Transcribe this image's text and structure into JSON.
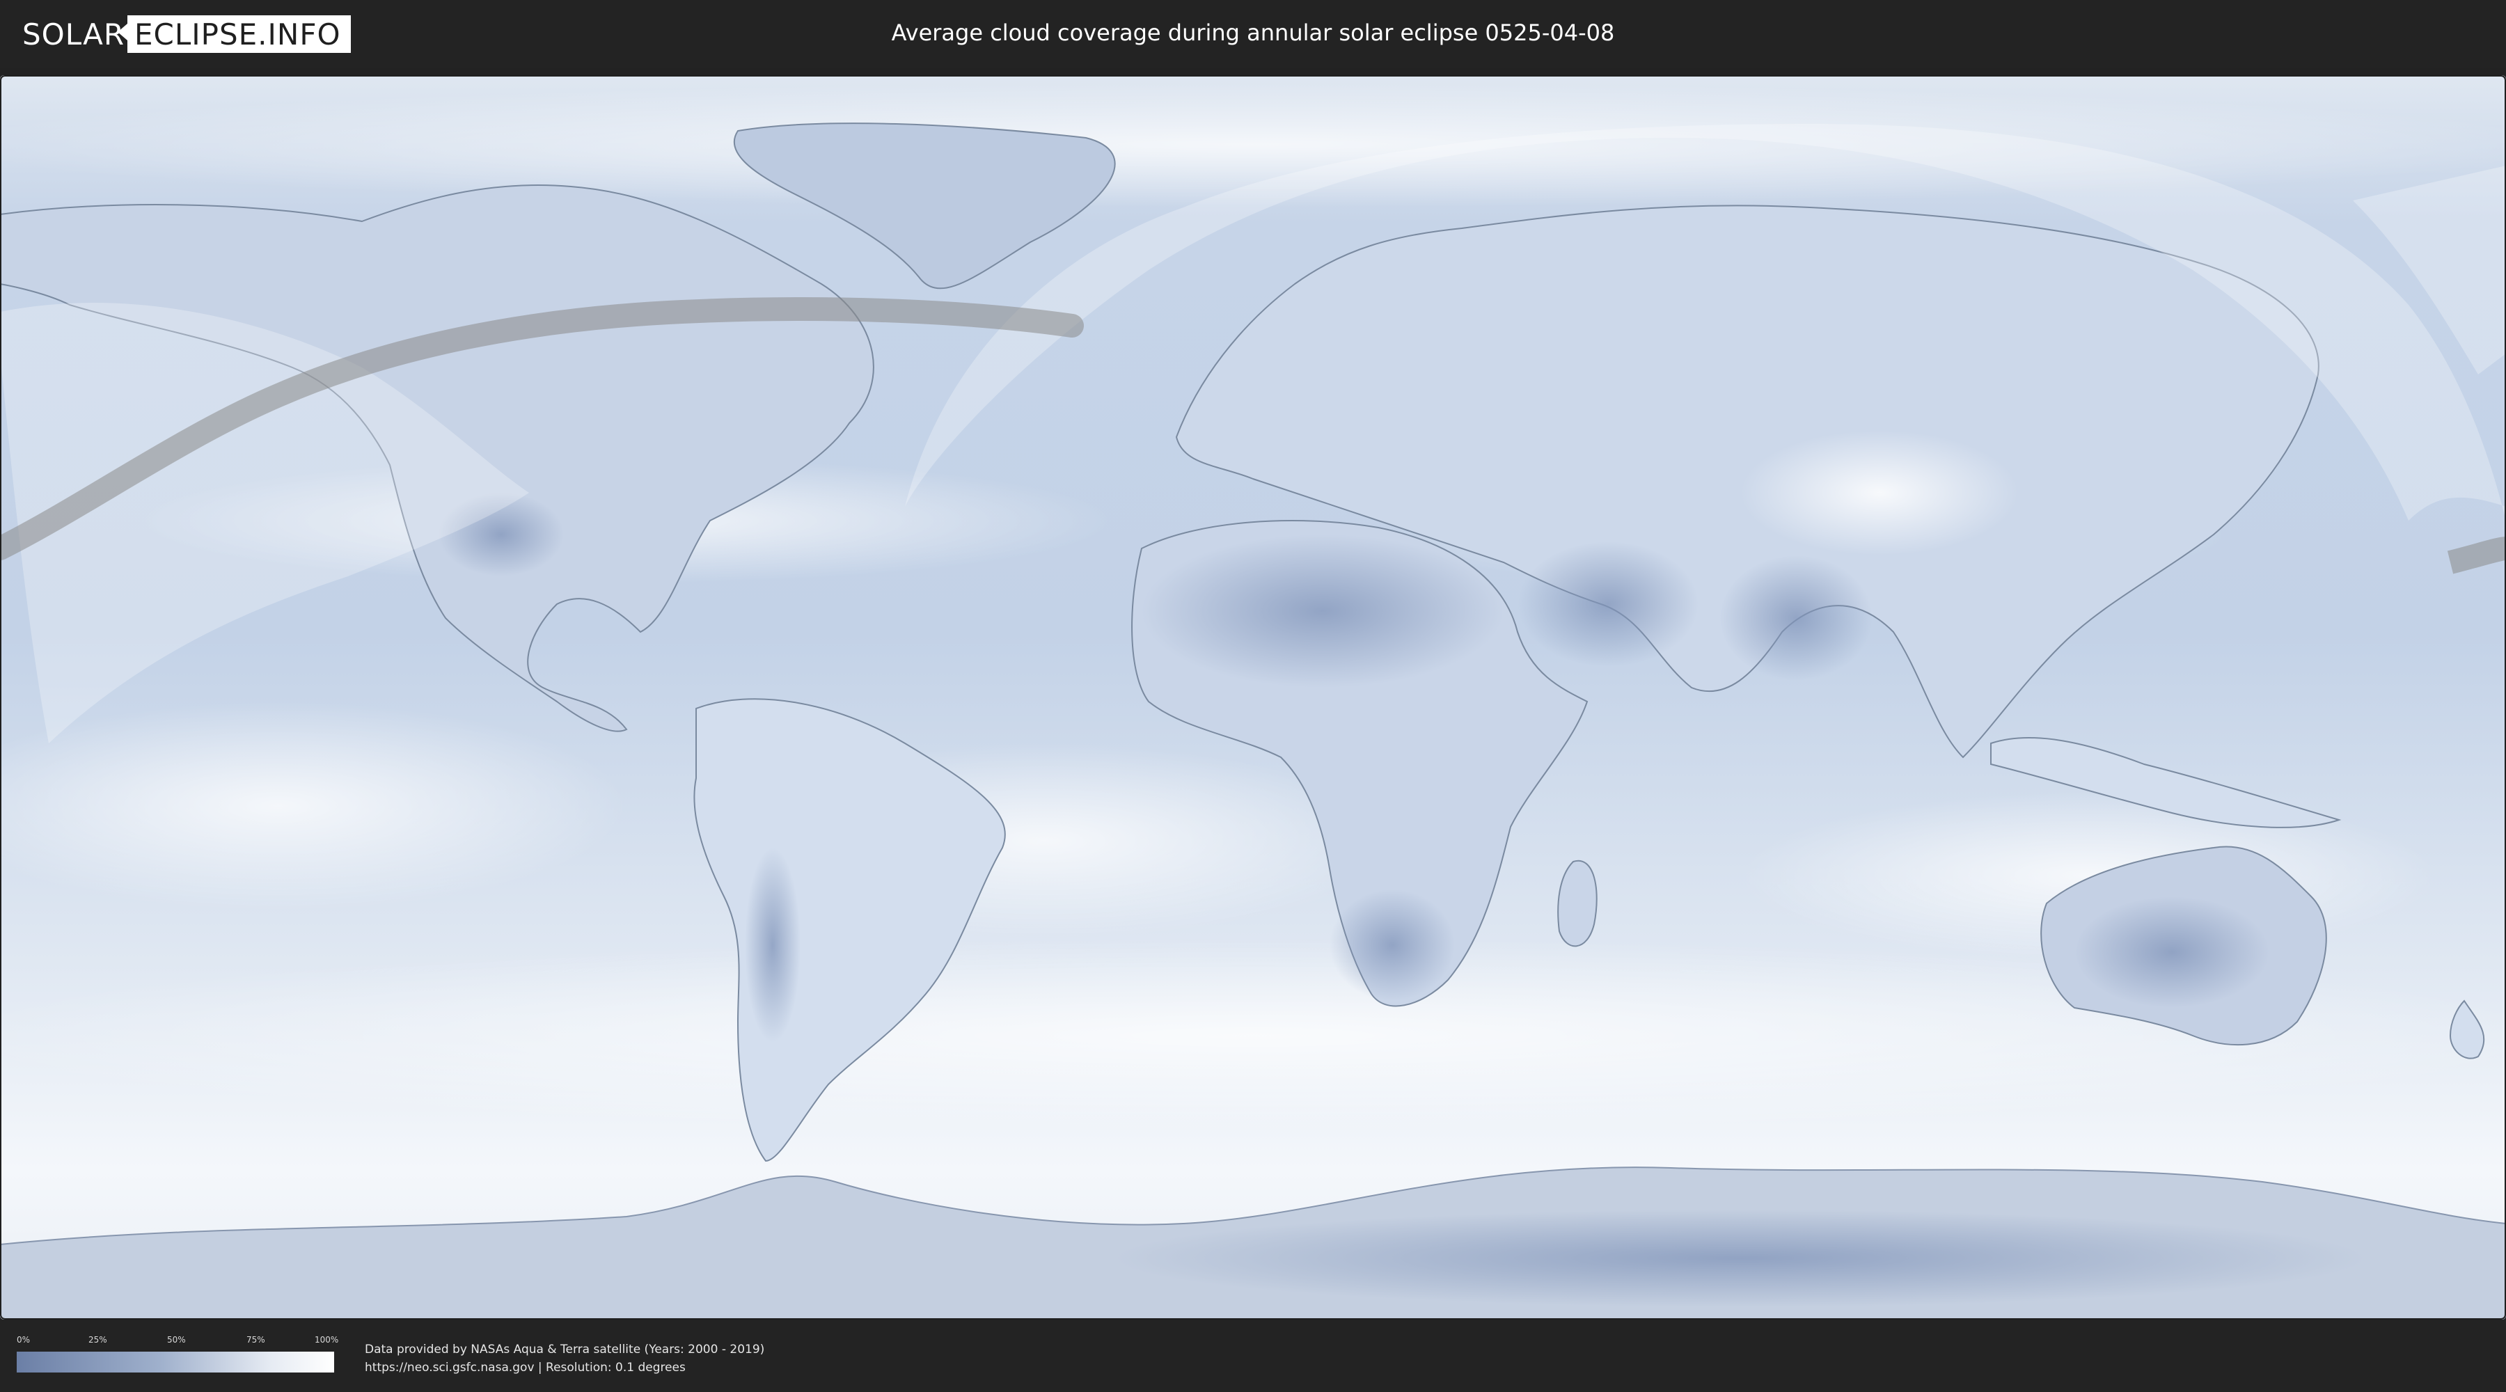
{
  "header": {
    "logo_left": "SOLAR",
    "logo_right": "ECLIPSE.INFO",
    "title": "Average cloud coverage during annular solar eclipse 0525-04-08"
  },
  "legend": {
    "ticks": [
      "0%",
      "25%",
      "50%",
      "75%",
      "100%"
    ],
    "tick_fractions": [
      0,
      0.25,
      0.5,
      0.75,
      1.0
    ],
    "colors": {
      "low": "#6b7fa6",
      "mid": "#9fb0cc",
      "high": "#ffffff"
    }
  },
  "credits": {
    "line1": "Data provided by NASAs Aqua & Terra satellite (Years: 2000 - 2019)",
    "line2": "https://neo.sci.gsfc.nasa.gov | Resolution: 0.1 degrees"
  },
  "map": {
    "projection": "equirectangular",
    "ocean_color": "#c9d6e8",
    "cloud_color": "#f3f6fa",
    "land_border_color": "#7a8aa0",
    "eclipse_path_color": "#8a8a8a",
    "visibility_overlay_color": "#ffffff"
  }
}
